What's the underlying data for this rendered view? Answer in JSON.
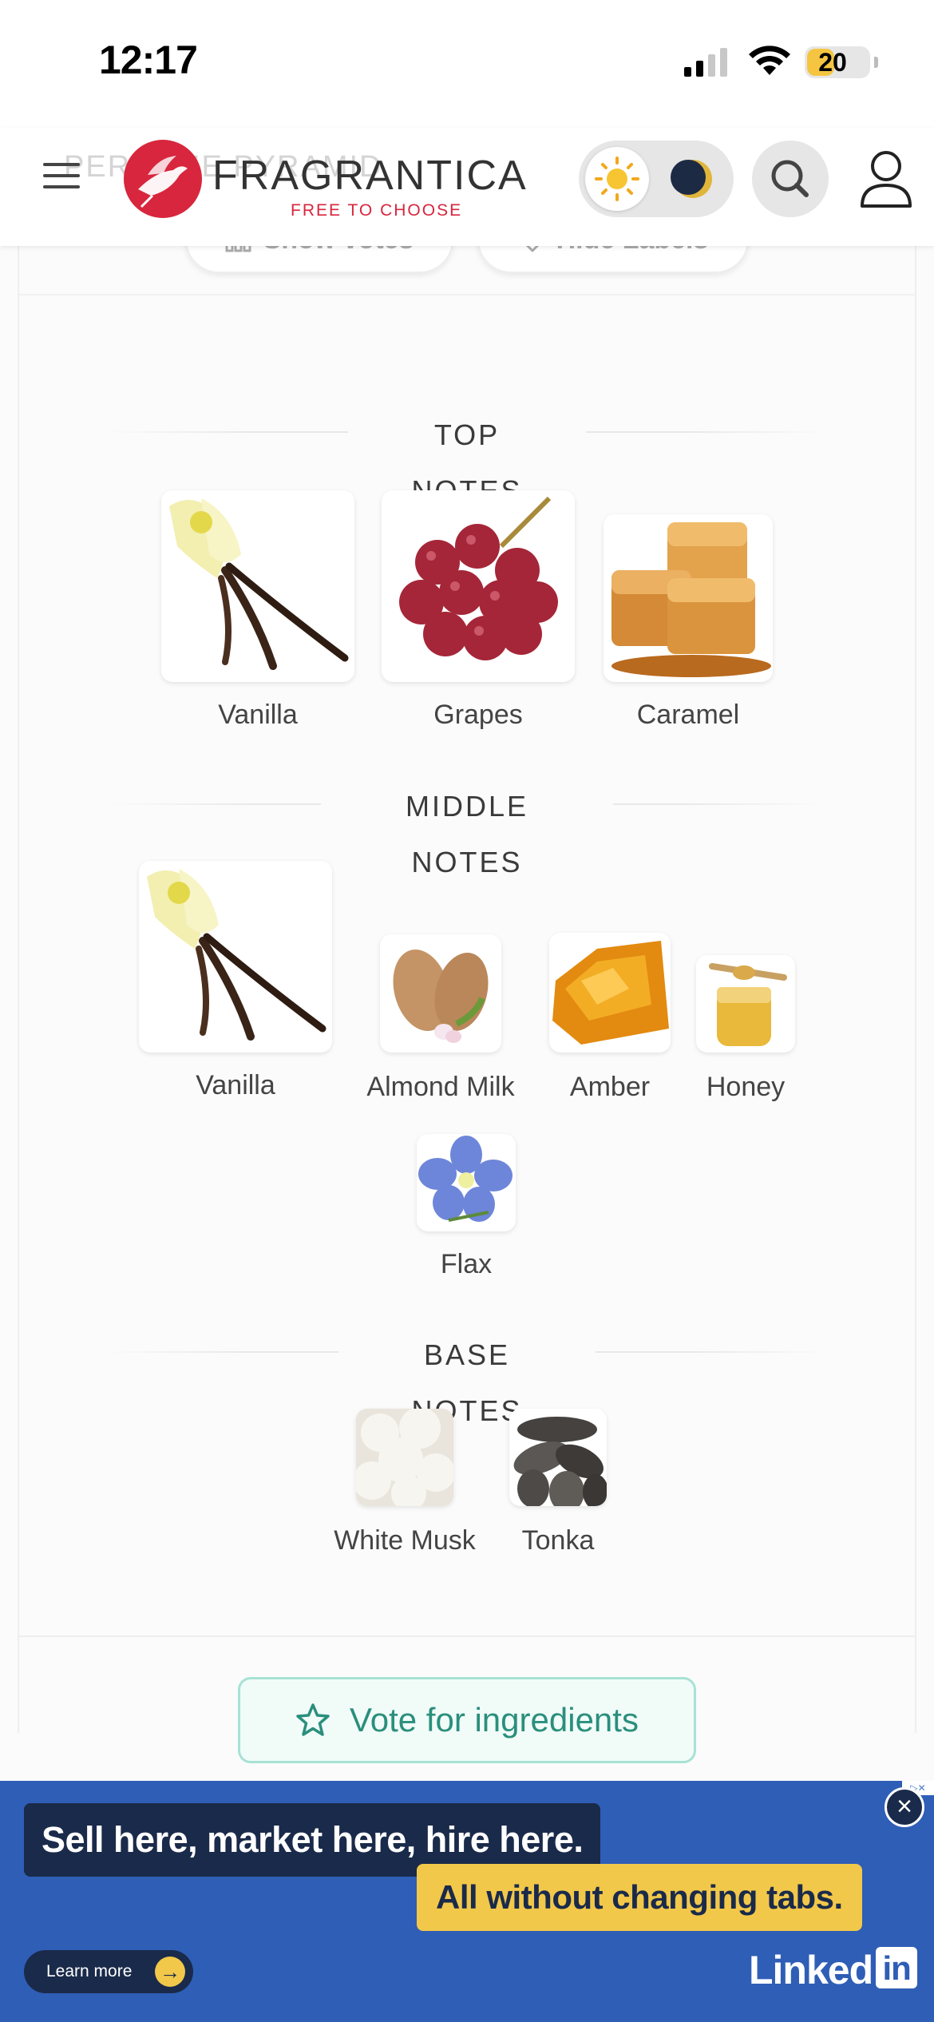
{
  "status_bar": {
    "time": "12:17",
    "battery": "20"
  },
  "header": {
    "ghost_title": "PERFUME PYRAMID",
    "logo_text": "FRAGRANTICA",
    "logo_tagline": "FREE TO CHOOSE"
  },
  "controls": {
    "show_votes": "Show votes",
    "hide_labels": "Hide Labels"
  },
  "pyramid": {
    "top": {
      "title": "TOP NOTES",
      "notes": [
        {
          "label": "Vanilla"
        },
        {
          "label": "Grapes"
        },
        {
          "label": "Caramel"
        }
      ]
    },
    "middle": {
      "title": "MIDDLE NOTES",
      "notes": [
        {
          "label": "Vanilla"
        },
        {
          "label": "Almond Milk"
        },
        {
          "label": "Amber"
        },
        {
          "label": "Honey"
        },
        {
          "label": "Flax"
        }
      ]
    },
    "base": {
      "title": "BASE NOTES",
      "notes": [
        {
          "label": "White Musk"
        },
        {
          "label": "Tonka"
        }
      ]
    }
  },
  "vote_button": "Vote for ingredients",
  "ad": {
    "line1": "Sell here, market here, hire here.",
    "line2": "All without changing tabs.",
    "cta": "Learn more",
    "brand": "Linked",
    "brand_in": "in"
  },
  "colors": {
    "brand_red": "#d7263d",
    "accent_teal": "#2a8f7c",
    "ad_blue": "#2f5eb6"
  }
}
